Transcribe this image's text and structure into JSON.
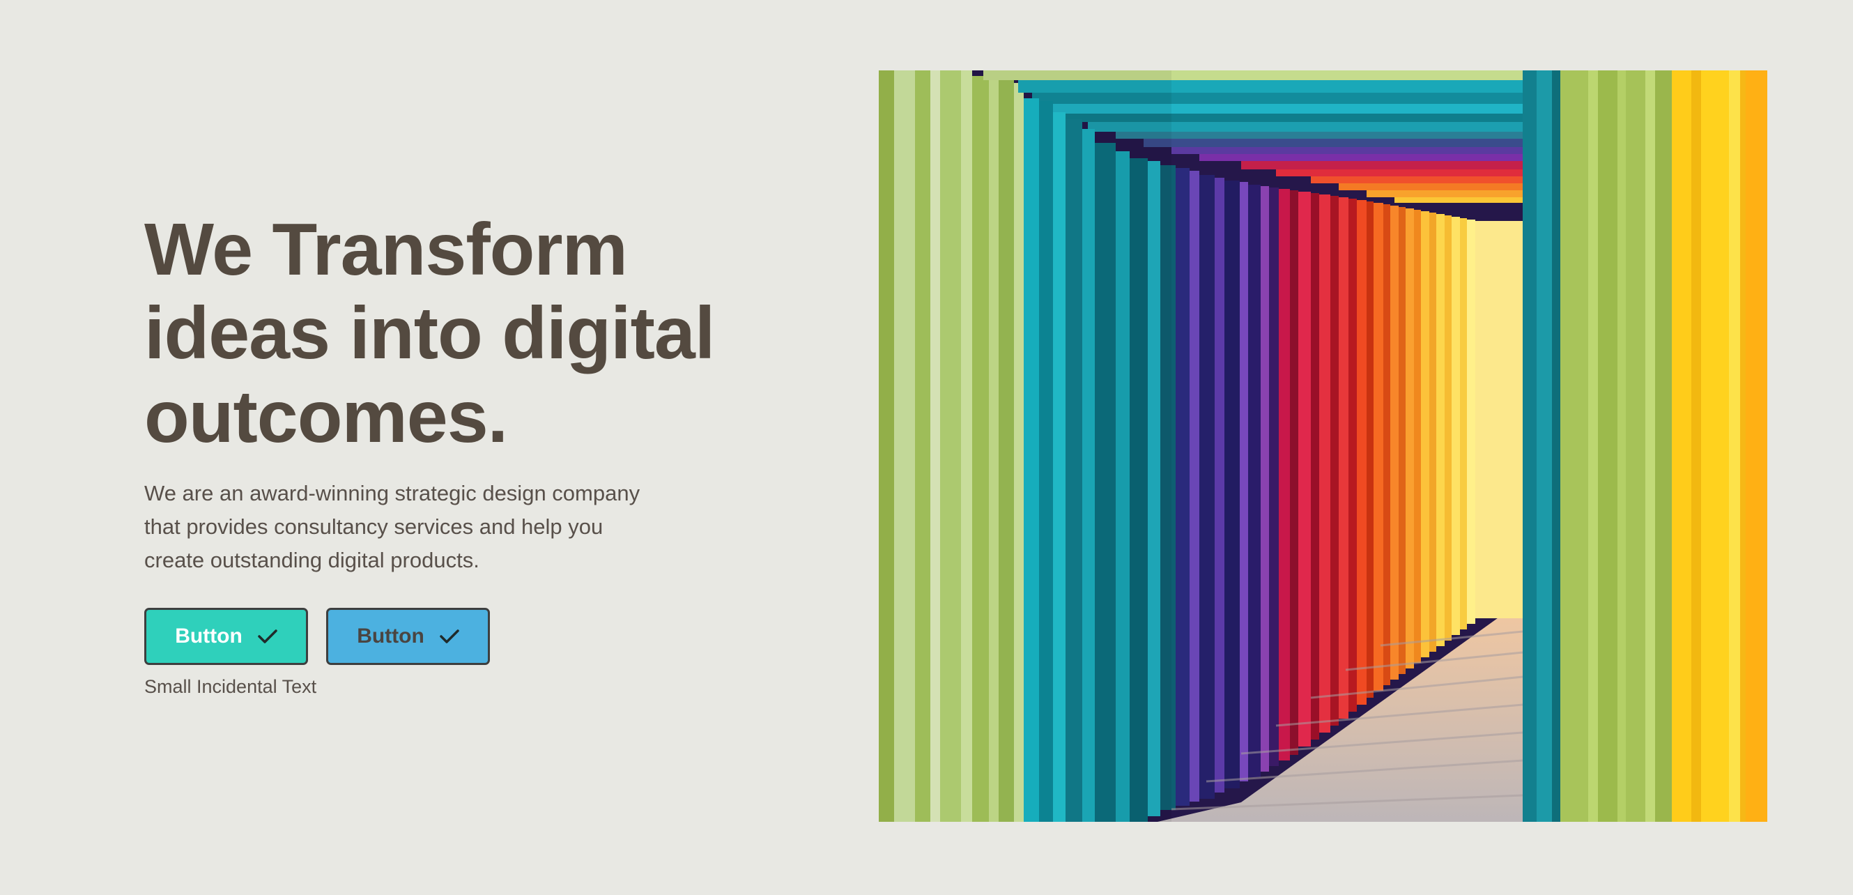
{
  "hero": {
    "headline_lines": [
      "We Transform",
      "ideas into digital",
      "outcomes."
    ],
    "description_lines": [
      "We are an award-winning strategic design company",
      "that provides consultancy services and help you",
      "create outstanding digital products."
    ],
    "primary_button": {
      "label": "Button",
      "icon": "check-icon"
    },
    "secondary_button": {
      "label": "Button",
      "icon": "check-icon"
    },
    "small_text": "Small Incidental Text"
  },
  "colors": {
    "background": "#e8e8e3",
    "text": "#544a40",
    "primary_button": "#2fd0bb",
    "secondary_button": "#4cb1e0"
  },
  "image": {
    "subject": "rainbow-colored wooden tunnel"
  }
}
